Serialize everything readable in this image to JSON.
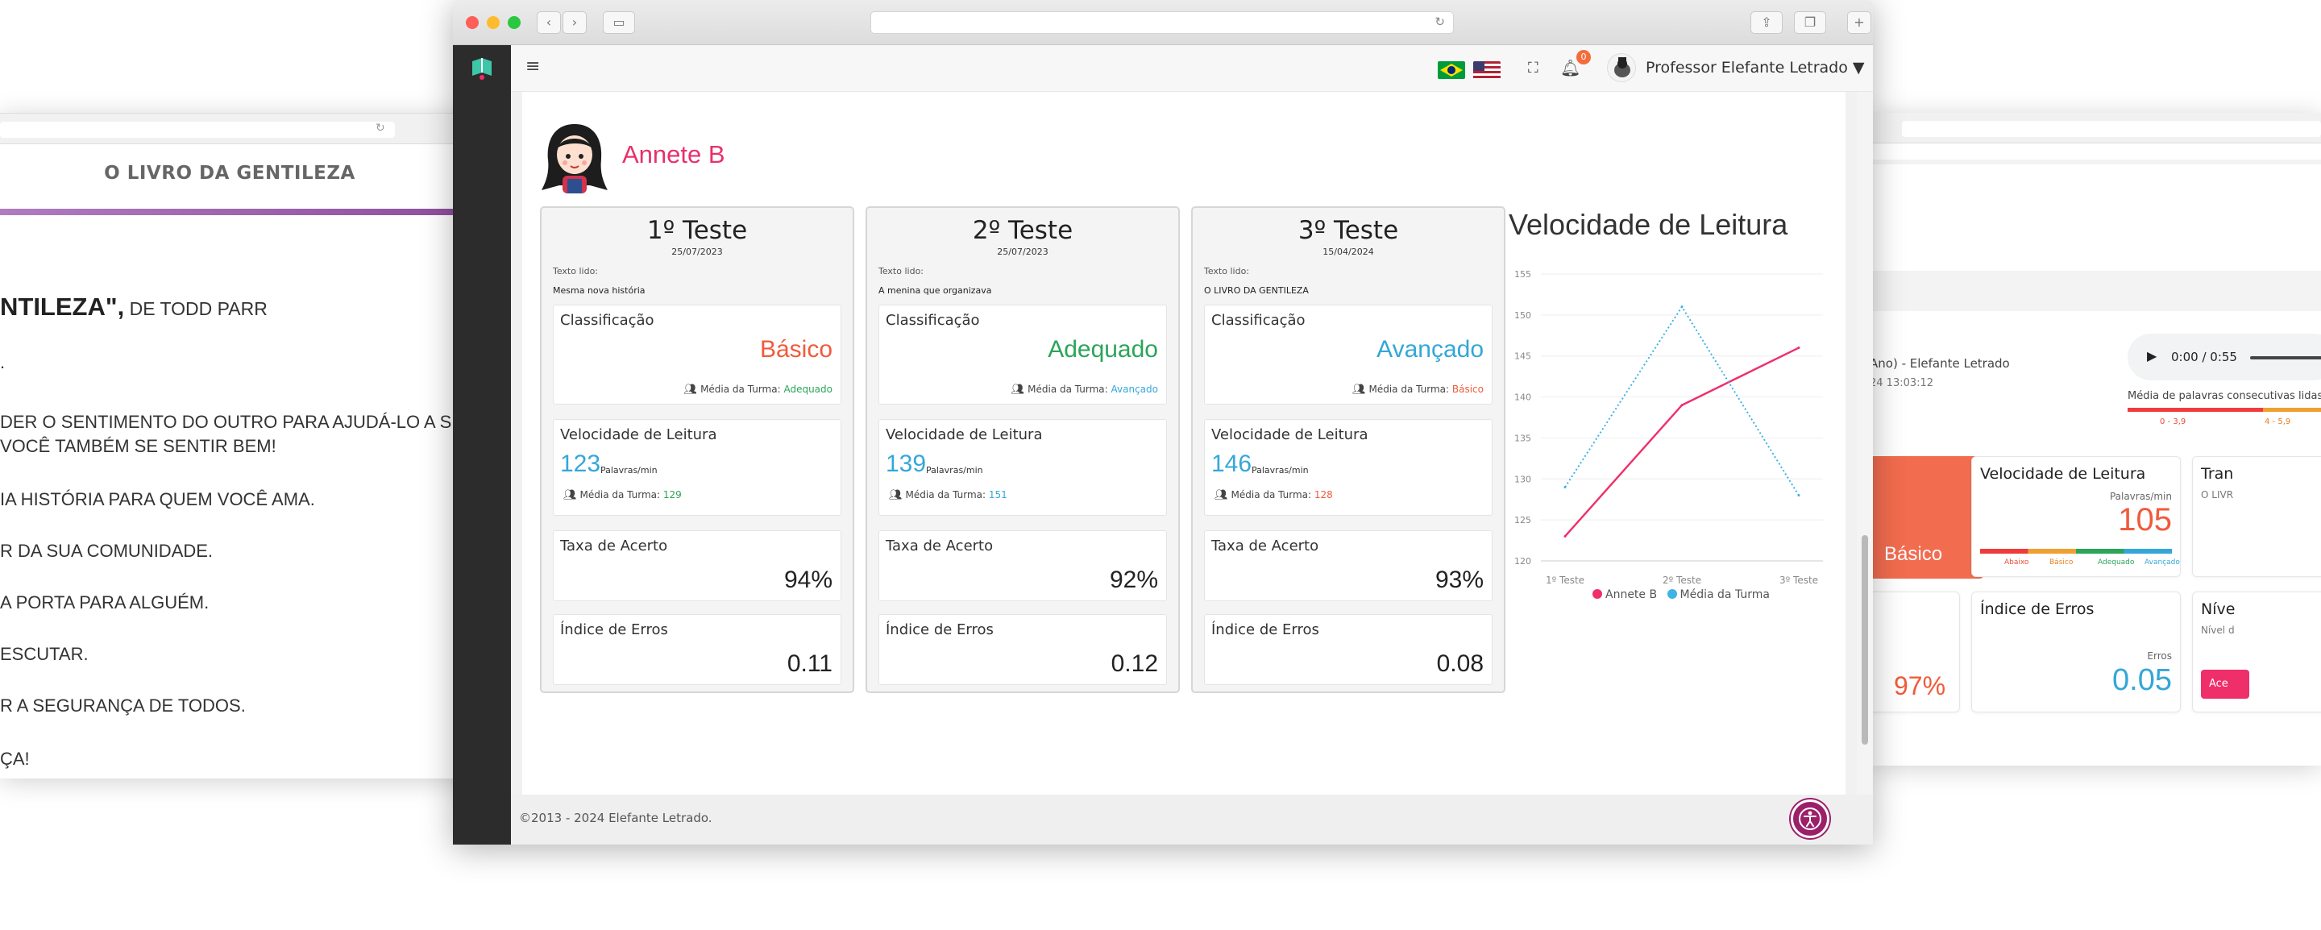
{
  "left_window": {
    "book_title": "O LIVRO DA GENTILEZA",
    "heading_bold": "NTILEZA\",",
    "heading_rest": " DE TODD PARR",
    "lines": [
      ".",
      "DER O SENTIMENTO DO OUTRO PARA AJUDÁ-LO A SE",
      "VOCÊ TAMBÉM SE SENTIR BEM!",
      "IA HISTÓRIA PARA QUEM VOCÊ AMA.",
      "R DA SUA COMUNIDADE.",
      "A PORTA PARA ALGUÉM.",
      "ESCUTAR.",
      "R A SEGURANÇA DE TODOS.",
      "ÇA!"
    ]
  },
  "right_window": {
    "recording_title": "Ano) - Elefante Letrado",
    "recording_date": "24 13:03:12",
    "audio_time": "0:00 / 0:55",
    "consecutive_label": "Média de palavras consecutivas lidas c",
    "scale_a": "0 - 3,9",
    "scale_b": "4 - 5,9",
    "classification": "Básico",
    "speed_title": "Velocidade de Leitura",
    "speed_unit": "Palavras/min",
    "speed_value": "105",
    "speed_scale": [
      "Abaixo",
      "Básico",
      "Adequado",
      "Avançado"
    ],
    "transcription_label": "Tran",
    "transcription_sub": "O LIVR",
    "accuracy": "97%",
    "errors_title": "Índice de Erros",
    "errors_unit": "Erros",
    "errors_value": "0.05",
    "level_label": "Níve",
    "level_sub": "Nível d",
    "level_button": "Ace"
  },
  "topbar": {
    "notifications": "0",
    "user_name": "Professor Elefante Letrado"
  },
  "student": {
    "name": "Annete B"
  },
  "labels": {
    "text_read": "Texto lido:",
    "classification": "Classificação",
    "class_avg": "Média da Turma:",
    "speed": "Velocidade de Leitura",
    "speed_unit": "Palavras/min",
    "accuracy": "Taxa de Acerto",
    "errors": "Índice de Erros"
  },
  "tests": [
    {
      "title": "1º Teste",
      "date": "25/07/2023",
      "text": "Mesma nova história",
      "classification": "Básico",
      "class_color": "#f05b3c",
      "class_avg": "Adequado",
      "class_avg_color": "#2aa55a",
      "speed": "123",
      "speed_avg": "129",
      "speed_avg_color": "#2aa55a",
      "accuracy": "94%",
      "errors": "0.11"
    },
    {
      "title": "2º Teste",
      "date": "25/07/2023",
      "text": "A menina que organizava",
      "classification": "Adequado",
      "class_color": "#2aa55a",
      "class_avg": "Avançado",
      "class_avg_color": "#34a7d8",
      "speed": "139",
      "speed_avg": "151",
      "speed_avg_color": "#34a7d8",
      "accuracy": "92%",
      "errors": "0.12"
    },
    {
      "title": "3º Teste",
      "date": "15/04/2024",
      "text": "O LIVRO DA GENTILEZA",
      "classification": "Avançado",
      "class_color": "#34a7d8",
      "class_avg": "Básico",
      "class_avg_color": "#f05b3c",
      "speed": "146",
      "speed_avg": "128",
      "speed_avg_color": "#f05b3c",
      "accuracy": "93%",
      "errors": "0.08"
    }
  ],
  "chart_data": {
    "type": "line",
    "title": "Velocidade de Leitura",
    "categories": [
      "1º Teste",
      "2º Teste",
      "3º Teste"
    ],
    "y_ticks": [
      120,
      125,
      130,
      135,
      140,
      145,
      150,
      155
    ],
    "ylim": [
      120,
      155
    ],
    "series": [
      {
        "name": "Annete B",
        "values": [
          123,
          139,
          146
        ],
        "color": "#ef2f6a",
        "style": "solid"
      },
      {
        "name": "Média da Turma",
        "values": [
          129,
          151,
          128
        ],
        "color": "#3fb3e3",
        "style": "dotted"
      }
    ],
    "legend": "bottom",
    "grid": true
  },
  "footer": {
    "copyright": "©2013 - 2024 Elefante Letrado."
  }
}
